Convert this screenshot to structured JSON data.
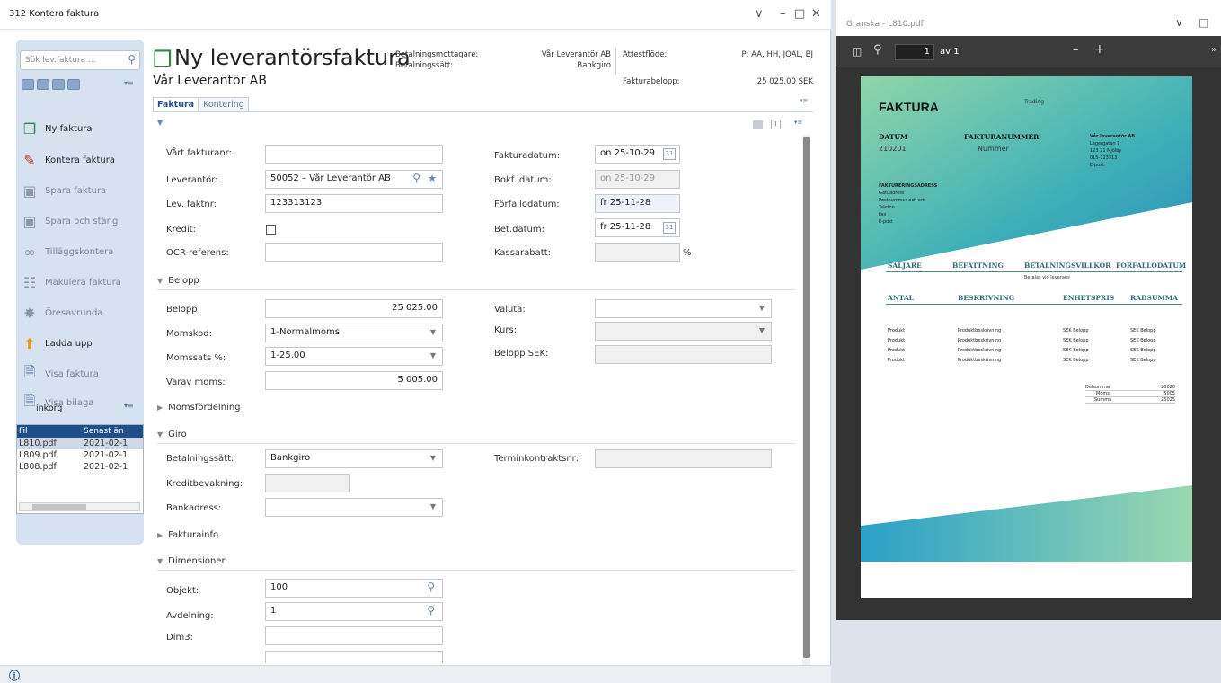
{
  "window": {
    "title": "312 Kontera faktura",
    "controls": {
      "chevron": "∨",
      "minimize": "–",
      "maximize": "□",
      "close": "✕"
    }
  },
  "sidebar": {
    "search_placeholder": "Sök lev.faktura ...",
    "items": [
      {
        "label": "Ny faktura",
        "icon": "new-invoice-icon"
      },
      {
        "label": "Kontera faktura",
        "icon": "account-invoice-icon"
      },
      {
        "label": "Spara faktura",
        "icon": "save-icon"
      },
      {
        "label": "Spara och stäng",
        "icon": "save-close-icon"
      },
      {
        "label": "Tilläggskontera",
        "icon": "additional-account-icon"
      },
      {
        "label": "Makulera faktura",
        "icon": "cancel-invoice-icon"
      },
      {
        "label": "Öresavrunda",
        "icon": "rounding-icon"
      },
      {
        "label": "Ladda upp",
        "icon": "upload-icon"
      },
      {
        "label": "Visa faktura",
        "icon": "view-invoice-icon"
      },
      {
        "label": "Visa bilaga",
        "icon": "view-attachment-icon"
      }
    ],
    "inbox_label": "inkorg",
    "files": {
      "headers": [
        "Fil",
        "Senast än"
      ],
      "rows": [
        {
          "name": "L810.pdf",
          "date": "2021-02-1"
        },
        {
          "name": "L809.pdf",
          "date": "2021-02-1"
        },
        {
          "name": "L808.pdf",
          "date": "2021-02-1"
        }
      ]
    }
  },
  "header": {
    "title": "Ny leverantörsfaktura",
    "subtitle": "Vår Leverantör AB",
    "betalningsmottagare_label": "Betalningsmottagare:",
    "betalningsmottagare_value": "Vår Leverantör AB",
    "betalningssatt_label": "Betalningssätt:",
    "betalningssatt_value": "Bankgiro",
    "attestflode_label": "Attestflöde:",
    "attestflode_value": "P: AA, HH, JOAL, BJ",
    "fakturabelopp_label": "Fakturabelopp:",
    "fakturabelopp_value": "25 025.00 SEK"
  },
  "tabs": [
    "Faktura",
    "Kontering"
  ],
  "form": {
    "vart_fakturanr": {
      "label": "Vårt fakturanr:",
      "value": ""
    },
    "leverantor": {
      "label": "Leverantör:",
      "value": "50052 – Vår Leverantör AB"
    },
    "lev_faktnr": {
      "label": "Lev. faktnr:",
      "value": "123313123"
    },
    "kredit": {
      "label": "Kredit:"
    },
    "ocr": {
      "label": "OCR-referens:",
      "value": ""
    },
    "fakturadatum": {
      "label": "Fakturadatum:",
      "value": "on 25-10-29"
    },
    "bokf_datum": {
      "label": "Bokf. datum:",
      "value": "on 25-10-29"
    },
    "forfallodatum": {
      "label": "Förfallodatum:",
      "value": "fr 25-11-28"
    },
    "bet_datum": {
      "label": "Bet.datum:",
      "value": "fr 25-11-28"
    },
    "kassarabatt": {
      "label": "Kassarabatt:",
      "unit": "%"
    },
    "belopp_section": "Belopp",
    "belopp": {
      "label": "Belopp:",
      "value": "25 025.00"
    },
    "momskod": {
      "label": "Momskod:",
      "value": "1-Normalmoms"
    },
    "momssats": {
      "label": "Momssats %:",
      "value": "1-25.00"
    },
    "varav_moms": {
      "label": "Varav moms:",
      "value": "5 005.00"
    },
    "valuta": {
      "label": "Valuta:",
      "value": ""
    },
    "kurs": {
      "label": "Kurs:",
      "value": ""
    },
    "belopp_sek": {
      "label": "Belopp SEK:",
      "value": ""
    },
    "momsfordelning_section": "Momsfördelning",
    "giro_section": "Giro",
    "betalningssatt": {
      "label": "Betalningssätt:",
      "value": "Bankgiro"
    },
    "terminkontraktsnr": {
      "label": "Terminkontraktsnr:",
      "value": ""
    },
    "kreditbevakning": {
      "label": "Kreditbevakning:",
      "value": ""
    },
    "bankadress": {
      "label": "Bankadress:",
      "value": ""
    },
    "fakturainfo_section": "Fakturainfo",
    "dimensioner_section": "Dimensioner",
    "objekt": {
      "label": "Objekt:",
      "value": "100"
    },
    "avdelning": {
      "label": "Avdelning:",
      "value": "1"
    },
    "dim3": {
      "label": "Dim3:",
      "value": ""
    }
  },
  "pdf": {
    "window_title": "Granska - L810.pdf",
    "page_number": "1",
    "page_of": "av 1",
    "zoom_minus": "–",
    "zoom_plus": "+",
    "doc": {
      "title": "FAKTURA",
      "trading": "Trading",
      "datum_label": "DATUM",
      "datum_value": "210201",
      "fakturanummer_label": "FAKTURANUMMER",
      "fakturanummer_value": "Nummer",
      "sender": [
        "Vår leverantör AB",
        "Lagergatan 1",
        "123 21 Mjölby",
        "015-123313",
        "E-post:"
      ],
      "billing_title": "FAKTURERINGSADRESS",
      "billing_lines": [
        "Gatuadress",
        "Postnummer och ort",
        "Telefon",
        "Fax",
        "E-post"
      ],
      "terms_headers": [
        "SÄLJARE",
        "BEFATTNING",
        "BETALNINGSVILLKOR",
        "FÖRFALLODATUM"
      ],
      "terms_value": "Betalas vid leverans",
      "item_headers": [
        "ANTAL",
        "BESKRIVNING",
        "ENHETSPRIS",
        "RADSUMMA"
      ],
      "rows": [
        [
          "Produkt",
          "Produktbeskrivning",
          "SEK Belopp",
          "SEK Belopp"
        ],
        [
          "Produkt",
          "Produktbeskrivning",
          "SEK Belopp",
          "SEK Belopp"
        ],
        [
          "Produkt",
          "Produktbeskrivning",
          "SEK Belopp",
          "SEK Belopp"
        ],
        [
          "Produkt",
          "Produktbeskrivning",
          "SEK Belopp",
          "SEK Belopp"
        ]
      ],
      "totals": [
        {
          "label": "Delsumma",
          "value": "20020"
        },
        {
          "label": "Moms",
          "value": "5005"
        },
        {
          "label": "Summa",
          "value": "25025"
        }
      ]
    }
  },
  "colors": {
    "accent": "#1e4f8c",
    "sidebar": "#d6e2f0",
    "pdf_teal": "#3fb0b8",
    "pdf_green": "#8fd6a8"
  }
}
